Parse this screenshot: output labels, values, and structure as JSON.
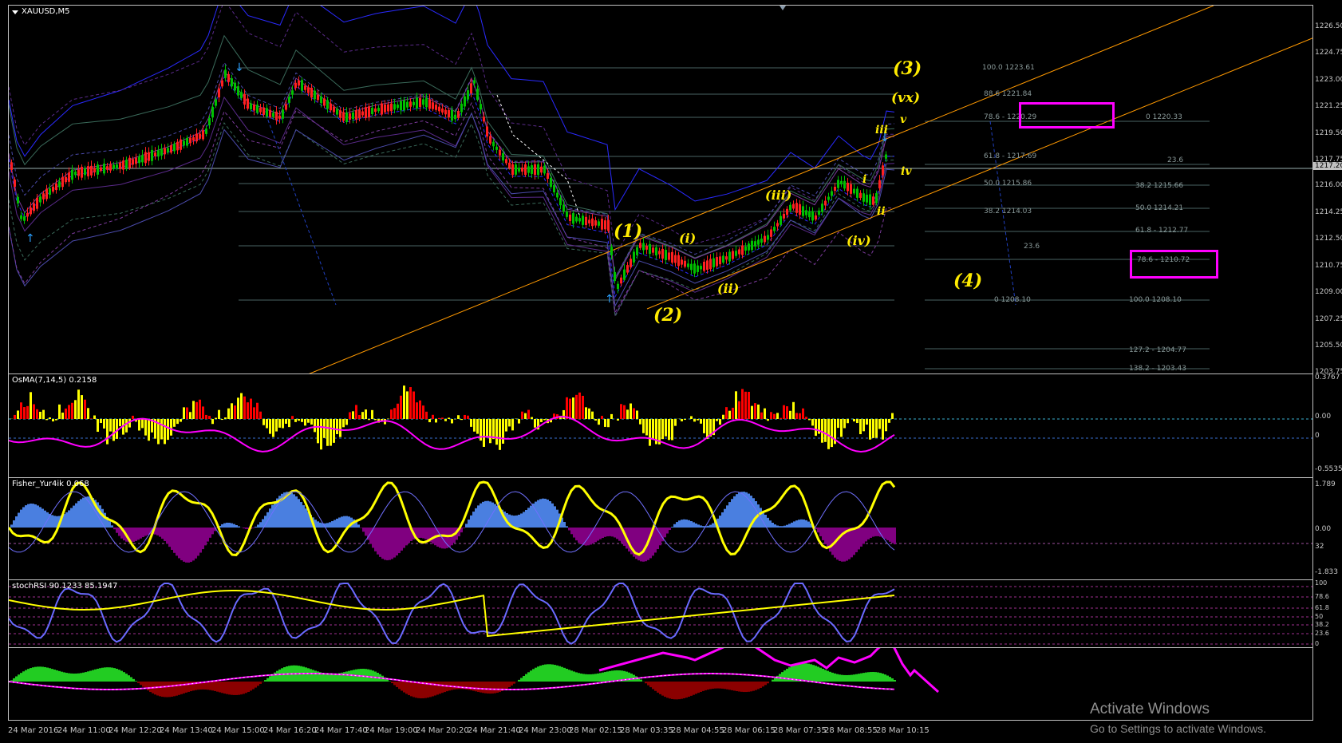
{
  "main": {
    "symbol": "XAUUSD,M5",
    "price_scale": [
      "1226.50",
      "1224.75",
      "1223.00",
      "1221.25",
      "1219.50",
      "1217.75",
      "1216.00",
      "1214.25",
      "1212.50",
      "1210.75",
      "1209.00",
      "1207.25",
      "1205.50",
      "1203.75"
    ],
    "current_price": "1217.20",
    "waves": {
      "w3": "(3)",
      "w1": "(1)",
      "w2": "(2)",
      "w4": "(4)",
      "wvx": "(vx)",
      "wi": "(i)",
      "wii": "(ii)",
      "wiii": "(iii)",
      "wiv": "(iv)",
      "v": "v",
      "iii": "iii",
      "iv": "iv",
      "i": "i",
      "ii": "ii"
    },
    "fib_left": [
      "100.0 1223.61",
      "88.6 1221.84",
      "78.6 - 1220.29",
      "61.8 - 1217.69",
      "50.0 1215.86",
      "38.2 1214.03",
      "23.6",
      "0 1208.10"
    ],
    "fib_right": [
      "0 1220.33",
      "23.6",
      "38.2 1215.66",
      "50.0 1214.21",
      "61.8 - 1212.77",
      "78.6 - 1210.72",
      "100.0 1208.10",
      "127.2 - 1204.77",
      "138.2 - 1203.43"
    ]
  },
  "osma": {
    "label": "OsMA(7,14,5) 0.2158",
    "scale": [
      "0.3767",
      "0.00",
      "0",
      "-0.5535"
    ]
  },
  "fisher": {
    "label": "Fisher_Yur4ik 0.068",
    "scale": [
      "1.789",
      "0.00",
      "32",
      "-1.833"
    ]
  },
  "stoch": {
    "label": "stochRSI 90.1233 85.1947",
    "scale": [
      "100",
      "78.6",
      "61.8",
      "50",
      "38.2",
      "23.6",
      "0"
    ]
  },
  "time_axis": [
    "24 Mar 2016",
    "24 Mar 11:00",
    "24 Mar 12:20",
    "24 Mar 13:40",
    "24 Mar 15:00",
    "24 Mar 16:20",
    "24 Mar 17:40",
    "24 Mar 19:00",
    "24 Mar 20:20",
    "24 Mar 21:40",
    "24 Mar 23:00",
    "28 Mar 02:15",
    "28 Mar 03:35",
    "28 Mar 04:55",
    "28 Mar 06:15",
    "28 Mar 07:35",
    "28 Mar 08:55",
    "28 Mar 10:15"
  ],
  "watermark": {
    "line1": "Activate Windows",
    "line2": "Go to Settings to activate Windows."
  },
  "colors": {
    "bull": "#00c000",
    "bear": "#ff2020",
    "fib": "#4a6464",
    "channel": "#ff9900",
    "wave": "#ffeb00",
    "magenta": "#ff00ff",
    "hist_yellow": "#ffff00",
    "hist_red": "#ff0000",
    "fisher_blue": "#4a7fe0",
    "fisher_purple": "#800080",
    "green_hist": "#22cc22",
    "dark_red": "#8b0000"
  }
}
